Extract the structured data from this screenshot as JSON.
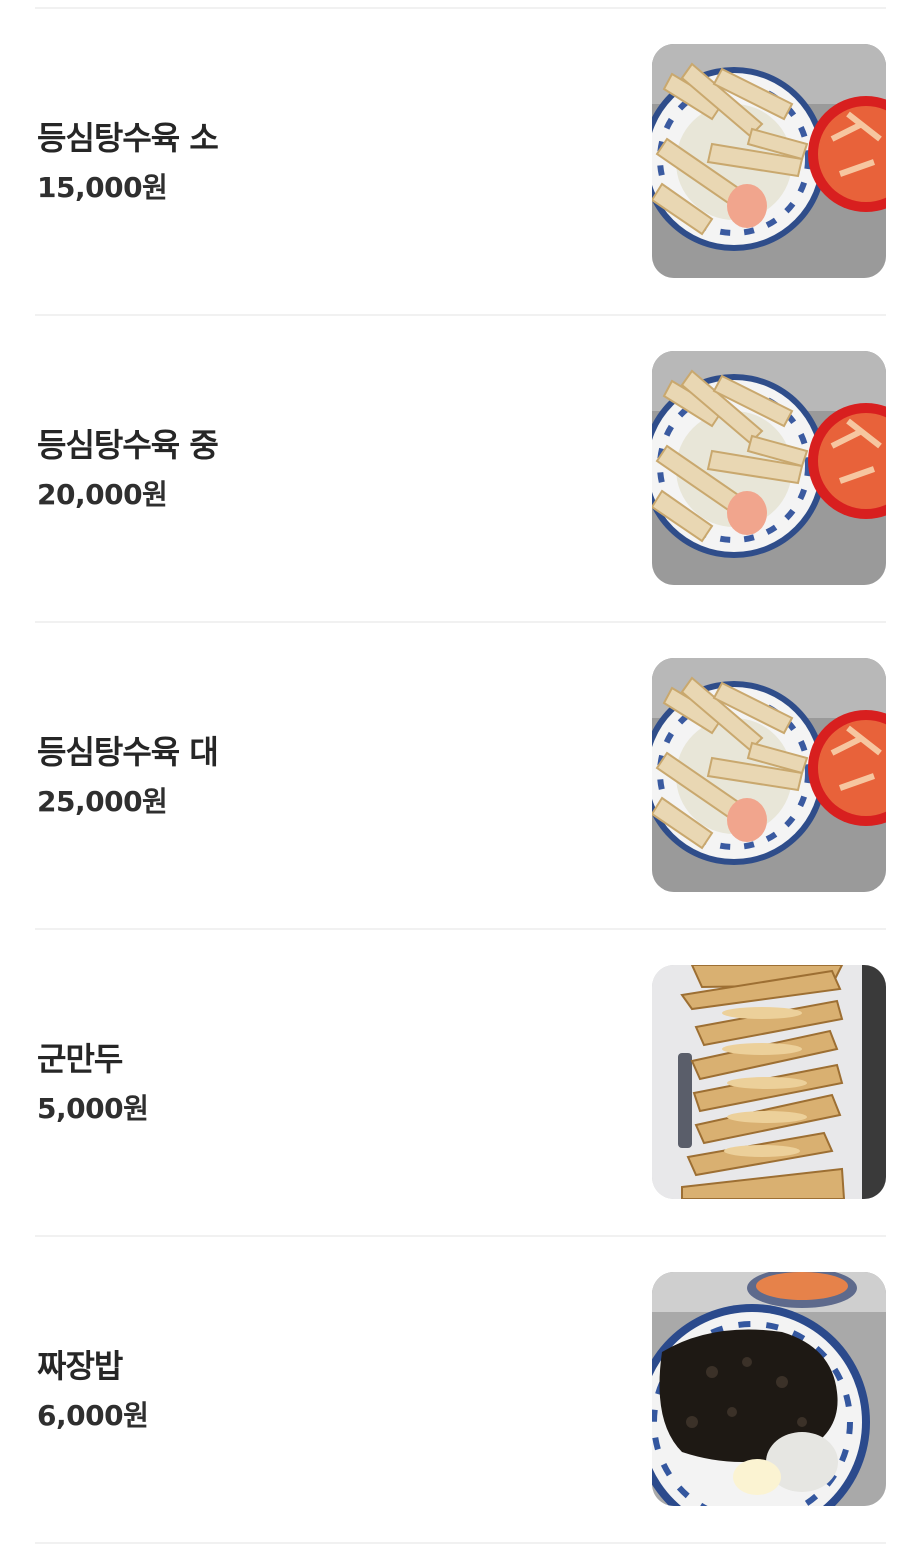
{
  "menu": {
    "items": [
      {
        "name": "등심탕수육 소",
        "price": "15,000원",
        "image": "sweet-sour-pork-photo"
      },
      {
        "name": "등심탕수육 중",
        "price": "20,000원",
        "image": "sweet-sour-pork-photo"
      },
      {
        "name": "등심탕수육 대",
        "price": "25,000원",
        "image": "sweet-sour-pork-photo"
      },
      {
        "name": "군만두",
        "price": "5,000원",
        "image": "fried-dumplings-photo"
      },
      {
        "name": "짜장밥",
        "price": "6,000원",
        "image": "jjajang-rice-photo"
      }
    ]
  },
  "colors": {
    "text": "#262626",
    "divider": "#f1f1f1",
    "background": "#ffffff"
  }
}
